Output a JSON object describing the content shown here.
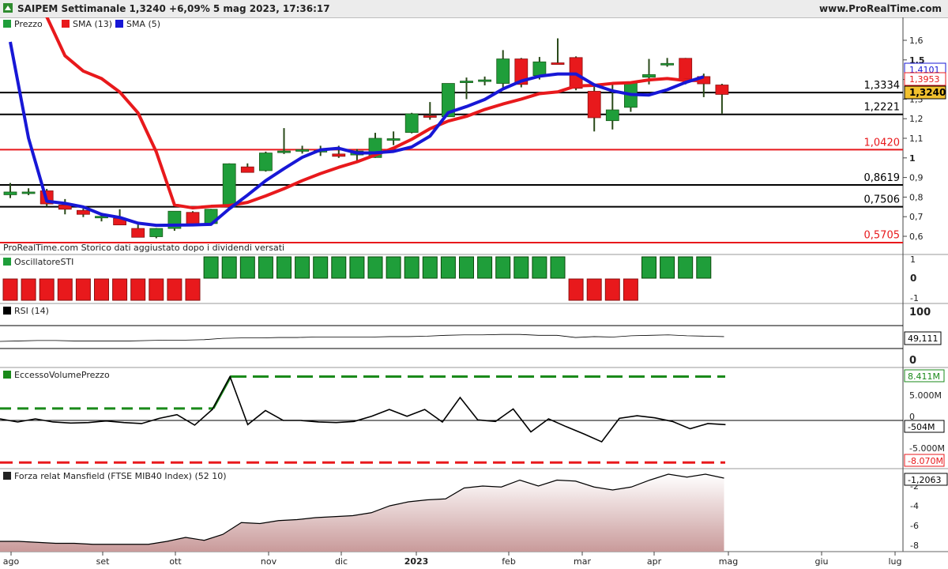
{
  "header": {
    "title": "SAIPEM Settimanale 1,3240 +6,09% 5 mag 2023, 17:36:17",
    "site": "www.ProRealTime.com"
  },
  "legend": {
    "price": "Prezzo",
    "sma13": "SMA (13)",
    "sma5": "SMA (5)"
  },
  "note": "ProRealTime.com Storico dati aggiustato dopo i dividendi versati",
  "panels": {
    "sti": "OscillatoreSTI",
    "rsi": "RSI (14)",
    "evp": "EccessoVolumePrezzo",
    "mansfield": "Forza relat Mansfield (FTSE MIB40 Index) (52 10)"
  },
  "colors": {
    "up": "#1f9e3a",
    "down": "#e8191c",
    "sma13": "#e8191c",
    "sma5": "#1717d6",
    "support": "#000000",
    "red_level": "#e8191c",
    "green_dash": "#1a8a1a"
  },
  "chart_data": [
    {
      "type": "candlestick",
      "title": "SAIPEM Settimanale",
      "ylim": [
        0.55,
        1.68
      ],
      "y_ticks": [
        "1,6",
        "1,5",
        "1,4",
        "1,3",
        "1,2",
        "1,1",
        "1",
        "0,9",
        "0,8",
        "0,7",
        "0,6"
      ],
      "x_labels": [
        "ago",
        "set",
        "ott",
        "nov",
        "dic",
        "2023",
        "feb",
        "mar",
        "apr",
        "mag",
        "giu",
        "lug"
      ],
      "ohlc": [
        [
          0.812,
          0.872,
          0.795,
          0.826
        ],
        [
          0.823,
          0.845,
          0.81,
          0.826
        ],
        [
          0.832,
          0.842,
          0.752,
          0.765
        ],
        [
          0.76,
          0.79,
          0.712,
          0.738
        ],
        [
          0.732,
          0.742,
          0.698,
          0.712
        ],
        [
          0.702,
          0.72,
          0.676,
          0.702
        ],
        [
          0.692,
          0.738,
          0.661,
          0.658
        ],
        [
          0.64,
          0.66,
          0.595,
          0.595
        ],
        [
          0.598,
          0.642,
          0.59,
          0.64
        ],
        [
          0.64,
          0.728,
          0.628,
          0.728
        ],
        [
          0.722,
          0.728,
          0.663,
          0.662
        ],
        [
          0.665,
          0.74,
          0.66,
          0.738
        ],
        [
          0.75,
          0.972,
          0.745,
          0.97
        ],
        [
          0.954,
          0.972,
          0.925,
          0.926
        ],
        [
          0.935,
          1.032,
          0.93,
          1.025
        ],
        [
          1.03,
          1.152,
          1.02,
          1.035
        ],
        [
          1.04,
          1.062,
          1.022,
          1.042
        ],
        [
          1.032,
          1.062,
          1.01,
          1.038
        ],
        [
          1.02,
          1.062,
          1.0,
          1.008
        ],
        [
          1.015,
          1.045,
          0.985,
          1.035
        ],
        [
          1.002,
          1.128,
          1.0,
          1.1
        ],
        [
          1.098,
          1.135,
          1.065,
          1.098
        ],
        [
          1.13,
          1.23,
          1.125,
          1.225
        ],
        [
          1.215,
          1.285,
          1.195,
          1.21
        ],
        [
          1.21,
          1.38,
          1.21,
          1.38
        ],
        [
          1.385,
          1.41,
          1.3,
          1.392
        ],
        [
          1.398,
          1.415,
          1.37,
          1.398
        ],
        [
          1.38,
          1.55,
          1.36,
          1.505
        ],
        [
          1.505,
          1.51,
          1.36,
          1.375
        ],
        [
          1.42,
          1.515,
          1.4,
          1.49
        ],
        [
          1.485,
          1.61,
          1.48,
          1.482
        ],
        [
          1.512,
          1.518,
          1.345,
          1.355
        ],
        [
          1.34,
          1.378,
          1.135,
          1.205
        ],
        [
          1.19,
          1.375,
          1.145,
          1.245
        ],
        [
          1.258,
          1.39,
          1.235,
          1.385
        ],
        [
          1.412,
          1.505,
          1.375,
          1.425
        ],
        [
          1.475,
          1.51,
          1.465,
          1.482
        ],
        [
          1.508,
          1.51,
          1.375,
          1.402
        ],
        [
          1.415,
          1.43,
          1.31,
          1.378
        ],
        [
          1.372,
          1.378,
          1.226,
          1.324
        ]
      ],
      "sma13": [
        2.0,
        1.925,
        1.72,
        1.521,
        1.443,
        1.405,
        1.336,
        1.23,
        1.031,
        0.76,
        0.745,
        0.753,
        0.757,
        0.773,
        0.806,
        0.843,
        0.884,
        0.92,
        0.952,
        0.98,
        1.015,
        1.05,
        1.095,
        1.149,
        1.188,
        1.212,
        1.247,
        1.275,
        1.3,
        1.328,
        1.337,
        1.367,
        1.37,
        1.38,
        1.384,
        1.398,
        1.405,
        1.395,
        1.395
      ],
      "sma5": [
        1.592,
        1.101,
        0.779,
        0.768,
        0.75,
        0.712,
        0.696,
        0.667,
        0.656,
        0.657,
        0.658,
        0.661,
        0.74,
        0.81,
        0.884,
        0.945,
        1.003,
        1.041,
        1.049,
        1.025,
        1.026,
        1.033,
        1.056,
        1.111,
        1.231,
        1.262,
        1.298,
        1.352,
        1.392,
        1.417,
        1.428,
        1.428,
        1.373,
        1.342,
        1.324,
        1.321,
        1.348,
        1.385,
        1.414
      ],
      "levels": [
        {
          "label": "1,3334",
          "value": 1.3334,
          "color": "#000000"
        },
        {
          "label": "1,2221",
          "value": 1.2221,
          "color": "#000000"
        },
        {
          "label": "1,0420",
          "value": 1.042,
          "color": "#e8191c"
        },
        {
          "label": "0,8619",
          "value": 0.8619,
          "color": "#000000"
        },
        {
          "label": "0,7506",
          "value": 0.7506,
          "color": "#000000"
        },
        {
          "label": "0,5705",
          "value": 0.5705,
          "color": "#e8191c"
        }
      ],
      "price_tags": [
        {
          "label": "1,4101",
          "value": 1.4101,
          "color": "#1717d6"
        },
        {
          "label": "1,3953",
          "value": 1.3953,
          "color": "#e8191c"
        },
        {
          "label": "1,3240",
          "value": 1.324,
          "color": "#000000"
        }
      ]
    },
    {
      "type": "bar",
      "title": "OscillatoreSTI",
      "y_ticks": [
        "1",
        "0",
        "-1"
      ],
      "values": [
        -1,
        -1,
        -1,
        -1,
        -1,
        -1,
        -1,
        -1,
        -1,
        -1,
        -1,
        1,
        1,
        1,
        1,
        1,
        1,
        1,
        1,
        1,
        1,
        1,
        1,
        1,
        1,
        1,
        1,
        1,
        1,
        1,
        1,
        -1,
        -1,
        -1,
        -1,
        1,
        1,
        1,
        1
      ]
    },
    {
      "type": "line",
      "title": "RSI (14)",
      "y_ticks": [
        "100",
        "0"
      ],
      "last_label": "49,111",
      "values": [
        40,
        41,
        42,
        42,
        41,
        41,
        41,
        41,
        42,
        43,
        43,
        44,
        47,
        48,
        48,
        49,
        49,
        50,
        50,
        50,
        50,
        51,
        51,
        52,
        54,
        55,
        55,
        56,
        56,
        54,
        54,
        49,
        51,
        50,
        53,
        54,
        55,
        53,
        52,
        51
      ]
    },
    {
      "type": "line",
      "title": "EccessoVolumePrezzo",
      "y_ticks": [
        "5.000M",
        "0",
        "-5.000M"
      ],
      "tags": [
        "8.411M",
        "-504M",
        "-8.070M"
      ],
      "upper_dash": 8.411,
      "lower_dash": -8.07,
      "upper_early": 2.3,
      "values": [
        0.3,
        -0.3,
        0.3,
        -0.3,
        -0.5,
        -0.4,
        -0.1,
        -0.4,
        -0.6,
        0.4,
        1.1,
        -0.9,
        2.1,
        8.4,
        -0.8,
        1.9,
        0,
        0,
        -0.3,
        -0.4,
        -0.2,
        0.8,
        2.1,
        0.8,
        2.1,
        -0.3,
        4.4,
        0.1,
        -0.2,
        2.2,
        -2.2,
        0.3,
        -1.2,
        -2.6,
        -4.1,
        0.4,
        0.9,
        0.5,
        -0.2,
        -1.6,
        -0.6,
        -0.8
      ]
    },
    {
      "type": "area",
      "title": "Forza relat Mansfield (FTSE MIB40 Index) (52 10)",
      "y_ticks": [
        "-2",
        "-4",
        "-6",
        "-8"
      ],
      "last_label": "-1,2063",
      "values": [
        -7.6,
        -7.6,
        -7.7,
        -7.8,
        -7.8,
        -7.9,
        -7.9,
        -7.9,
        -7.9,
        -7.6,
        -7.2,
        -7.5,
        -6.9,
        -5.7,
        -5.8,
        -5.5,
        -5.4,
        -5.2,
        -5.1,
        -5.0,
        -4.7,
        -4.0,
        -3.6,
        -3.4,
        -3.3,
        -2.2,
        -2.0,
        -2.1,
        -1.4,
        -2.0,
        -1.4,
        -1.5,
        -2.1,
        -2.4,
        -2.1,
        -1.4,
        -0.8,
        -1.1,
        -0.8,
        -1.2
      ]
    }
  ]
}
